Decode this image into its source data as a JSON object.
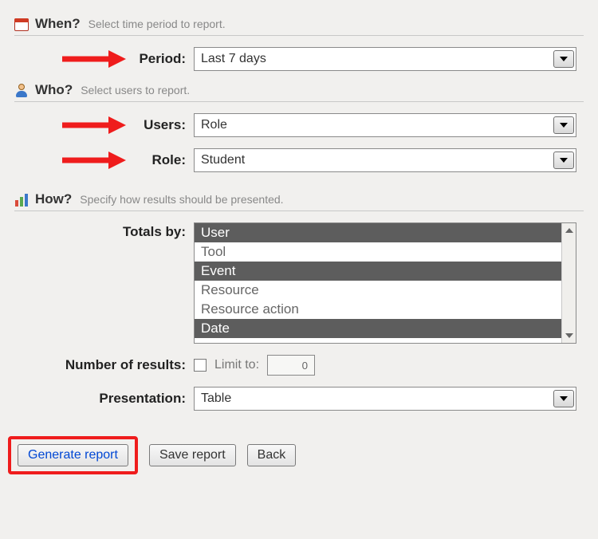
{
  "when": {
    "title": "When?",
    "hint": "Select time period to report.",
    "period_label": "Period:",
    "period_value": "Last 7 days"
  },
  "who": {
    "title": "Who?",
    "hint": "Select users to report.",
    "users_label": "Users:",
    "users_value": "Role",
    "role_label": "Role:",
    "role_value": "Student"
  },
  "how": {
    "title": "How?",
    "hint": "Specify how results should be presented.",
    "totals_label": "Totals by:",
    "totals_options": [
      {
        "label": "User",
        "selected": true
      },
      {
        "label": "Tool",
        "selected": false
      },
      {
        "label": "Event",
        "selected": true
      },
      {
        "label": "Resource",
        "selected": false
      },
      {
        "label": "Resource action",
        "selected": false
      },
      {
        "label": "Date",
        "selected": true
      }
    ],
    "num_results_label": "Number of results:",
    "limit_to_label": "Limit to:",
    "limit_to_checked": false,
    "limit_to_value": "0",
    "presentation_label": "Presentation:",
    "presentation_value": "Table"
  },
  "buttons": {
    "generate": "Generate report",
    "save": "Save report",
    "back": "Back"
  }
}
